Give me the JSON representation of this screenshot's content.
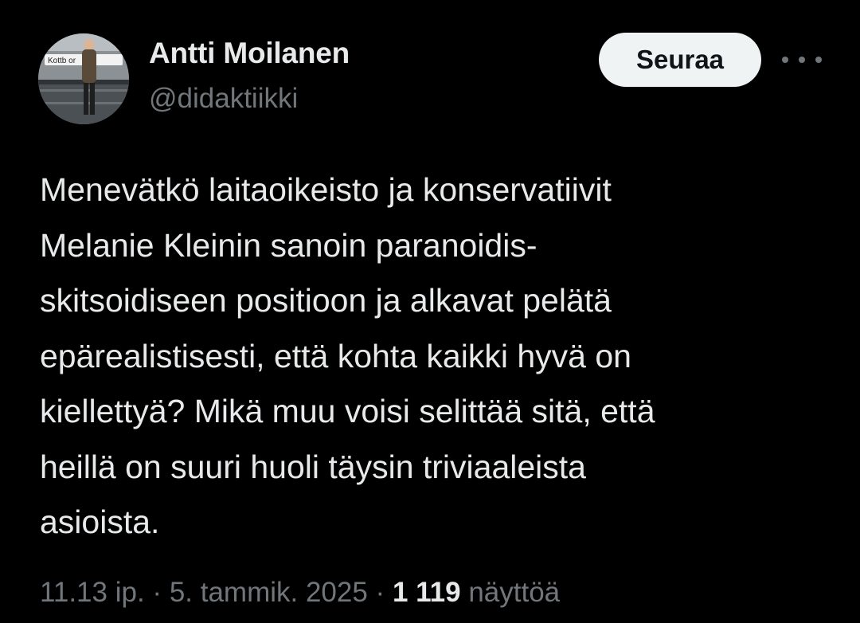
{
  "author": {
    "name": "Antti Moilanen",
    "handle": "@didaktiikki",
    "avatar_sign_text": "Kottb    or"
  },
  "follow_button": {
    "label": "Seuraa"
  },
  "more_button": {
    "icon": "more-horizontal-icon"
  },
  "tweet": {
    "lines": [
      "Menevätkö laitaoikeisto ja konservatiivit",
      "Melanie Kleinin sanoin paranoidis-",
      "skitsoidiseen positioon ja alkavat pelätä",
      "epärealistisesti, että kohta kaikki hyvä on",
      "kiellettyä? Mikä muu voisi selittää sitä, että",
      "heillä on suuri huoli täysin triviaaleista",
      "asioista."
    ]
  },
  "meta": {
    "time": "11.13 ip.",
    "separator_1": "·",
    "date": "5. tammik. 2025",
    "separator_2": "·",
    "views_count": "1 119",
    "views_label": "näyttöä"
  },
  "colors": {
    "background": "#000000",
    "primary_text": "#e7e9ea",
    "secondary_text": "#71767b",
    "follow_button_bg": "#eff3f4",
    "follow_button_text": "#0f1419"
  }
}
